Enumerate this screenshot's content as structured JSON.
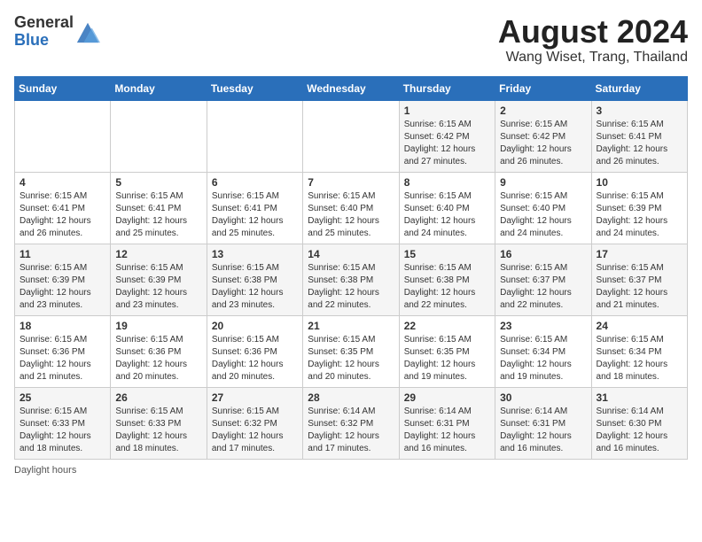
{
  "header": {
    "logo_general": "General",
    "logo_blue": "Blue",
    "month_year": "August 2024",
    "location": "Wang Wiset, Trang, Thailand"
  },
  "footer": {
    "note": "Daylight hours"
  },
  "days_of_week": [
    "Sunday",
    "Monday",
    "Tuesday",
    "Wednesday",
    "Thursday",
    "Friday",
    "Saturday"
  ],
  "weeks": [
    [
      {
        "day": "",
        "info": ""
      },
      {
        "day": "",
        "info": ""
      },
      {
        "day": "",
        "info": ""
      },
      {
        "day": "",
        "info": ""
      },
      {
        "day": "1",
        "info": "Sunrise: 6:15 AM\nSunset: 6:42 PM\nDaylight: 12 hours\nand 27 minutes."
      },
      {
        "day": "2",
        "info": "Sunrise: 6:15 AM\nSunset: 6:42 PM\nDaylight: 12 hours\nand 26 minutes."
      },
      {
        "day": "3",
        "info": "Sunrise: 6:15 AM\nSunset: 6:41 PM\nDaylight: 12 hours\nand 26 minutes."
      }
    ],
    [
      {
        "day": "4",
        "info": "Sunrise: 6:15 AM\nSunset: 6:41 PM\nDaylight: 12 hours\nand 26 minutes."
      },
      {
        "day": "5",
        "info": "Sunrise: 6:15 AM\nSunset: 6:41 PM\nDaylight: 12 hours\nand 25 minutes."
      },
      {
        "day": "6",
        "info": "Sunrise: 6:15 AM\nSunset: 6:41 PM\nDaylight: 12 hours\nand 25 minutes."
      },
      {
        "day": "7",
        "info": "Sunrise: 6:15 AM\nSunset: 6:40 PM\nDaylight: 12 hours\nand 25 minutes."
      },
      {
        "day": "8",
        "info": "Sunrise: 6:15 AM\nSunset: 6:40 PM\nDaylight: 12 hours\nand 24 minutes."
      },
      {
        "day": "9",
        "info": "Sunrise: 6:15 AM\nSunset: 6:40 PM\nDaylight: 12 hours\nand 24 minutes."
      },
      {
        "day": "10",
        "info": "Sunrise: 6:15 AM\nSunset: 6:39 PM\nDaylight: 12 hours\nand 24 minutes."
      }
    ],
    [
      {
        "day": "11",
        "info": "Sunrise: 6:15 AM\nSunset: 6:39 PM\nDaylight: 12 hours\nand 23 minutes."
      },
      {
        "day": "12",
        "info": "Sunrise: 6:15 AM\nSunset: 6:39 PM\nDaylight: 12 hours\nand 23 minutes."
      },
      {
        "day": "13",
        "info": "Sunrise: 6:15 AM\nSunset: 6:38 PM\nDaylight: 12 hours\nand 23 minutes."
      },
      {
        "day": "14",
        "info": "Sunrise: 6:15 AM\nSunset: 6:38 PM\nDaylight: 12 hours\nand 22 minutes."
      },
      {
        "day": "15",
        "info": "Sunrise: 6:15 AM\nSunset: 6:38 PM\nDaylight: 12 hours\nand 22 minutes."
      },
      {
        "day": "16",
        "info": "Sunrise: 6:15 AM\nSunset: 6:37 PM\nDaylight: 12 hours\nand 22 minutes."
      },
      {
        "day": "17",
        "info": "Sunrise: 6:15 AM\nSunset: 6:37 PM\nDaylight: 12 hours\nand 21 minutes."
      }
    ],
    [
      {
        "day": "18",
        "info": "Sunrise: 6:15 AM\nSunset: 6:36 PM\nDaylight: 12 hours\nand 21 minutes."
      },
      {
        "day": "19",
        "info": "Sunrise: 6:15 AM\nSunset: 6:36 PM\nDaylight: 12 hours\nand 20 minutes."
      },
      {
        "day": "20",
        "info": "Sunrise: 6:15 AM\nSunset: 6:36 PM\nDaylight: 12 hours\nand 20 minutes."
      },
      {
        "day": "21",
        "info": "Sunrise: 6:15 AM\nSunset: 6:35 PM\nDaylight: 12 hours\nand 20 minutes."
      },
      {
        "day": "22",
        "info": "Sunrise: 6:15 AM\nSunset: 6:35 PM\nDaylight: 12 hours\nand 19 minutes."
      },
      {
        "day": "23",
        "info": "Sunrise: 6:15 AM\nSunset: 6:34 PM\nDaylight: 12 hours\nand 19 minutes."
      },
      {
        "day": "24",
        "info": "Sunrise: 6:15 AM\nSunset: 6:34 PM\nDaylight: 12 hours\nand 18 minutes."
      }
    ],
    [
      {
        "day": "25",
        "info": "Sunrise: 6:15 AM\nSunset: 6:33 PM\nDaylight: 12 hours\nand 18 minutes."
      },
      {
        "day": "26",
        "info": "Sunrise: 6:15 AM\nSunset: 6:33 PM\nDaylight: 12 hours\nand 18 minutes."
      },
      {
        "day": "27",
        "info": "Sunrise: 6:15 AM\nSunset: 6:32 PM\nDaylight: 12 hours\nand 17 minutes."
      },
      {
        "day": "28",
        "info": "Sunrise: 6:14 AM\nSunset: 6:32 PM\nDaylight: 12 hours\nand 17 minutes."
      },
      {
        "day": "29",
        "info": "Sunrise: 6:14 AM\nSunset: 6:31 PM\nDaylight: 12 hours\nand 16 minutes."
      },
      {
        "day": "30",
        "info": "Sunrise: 6:14 AM\nSunset: 6:31 PM\nDaylight: 12 hours\nand 16 minutes."
      },
      {
        "day": "31",
        "info": "Sunrise: 6:14 AM\nSunset: 6:30 PM\nDaylight: 12 hours\nand 16 minutes."
      }
    ]
  ]
}
